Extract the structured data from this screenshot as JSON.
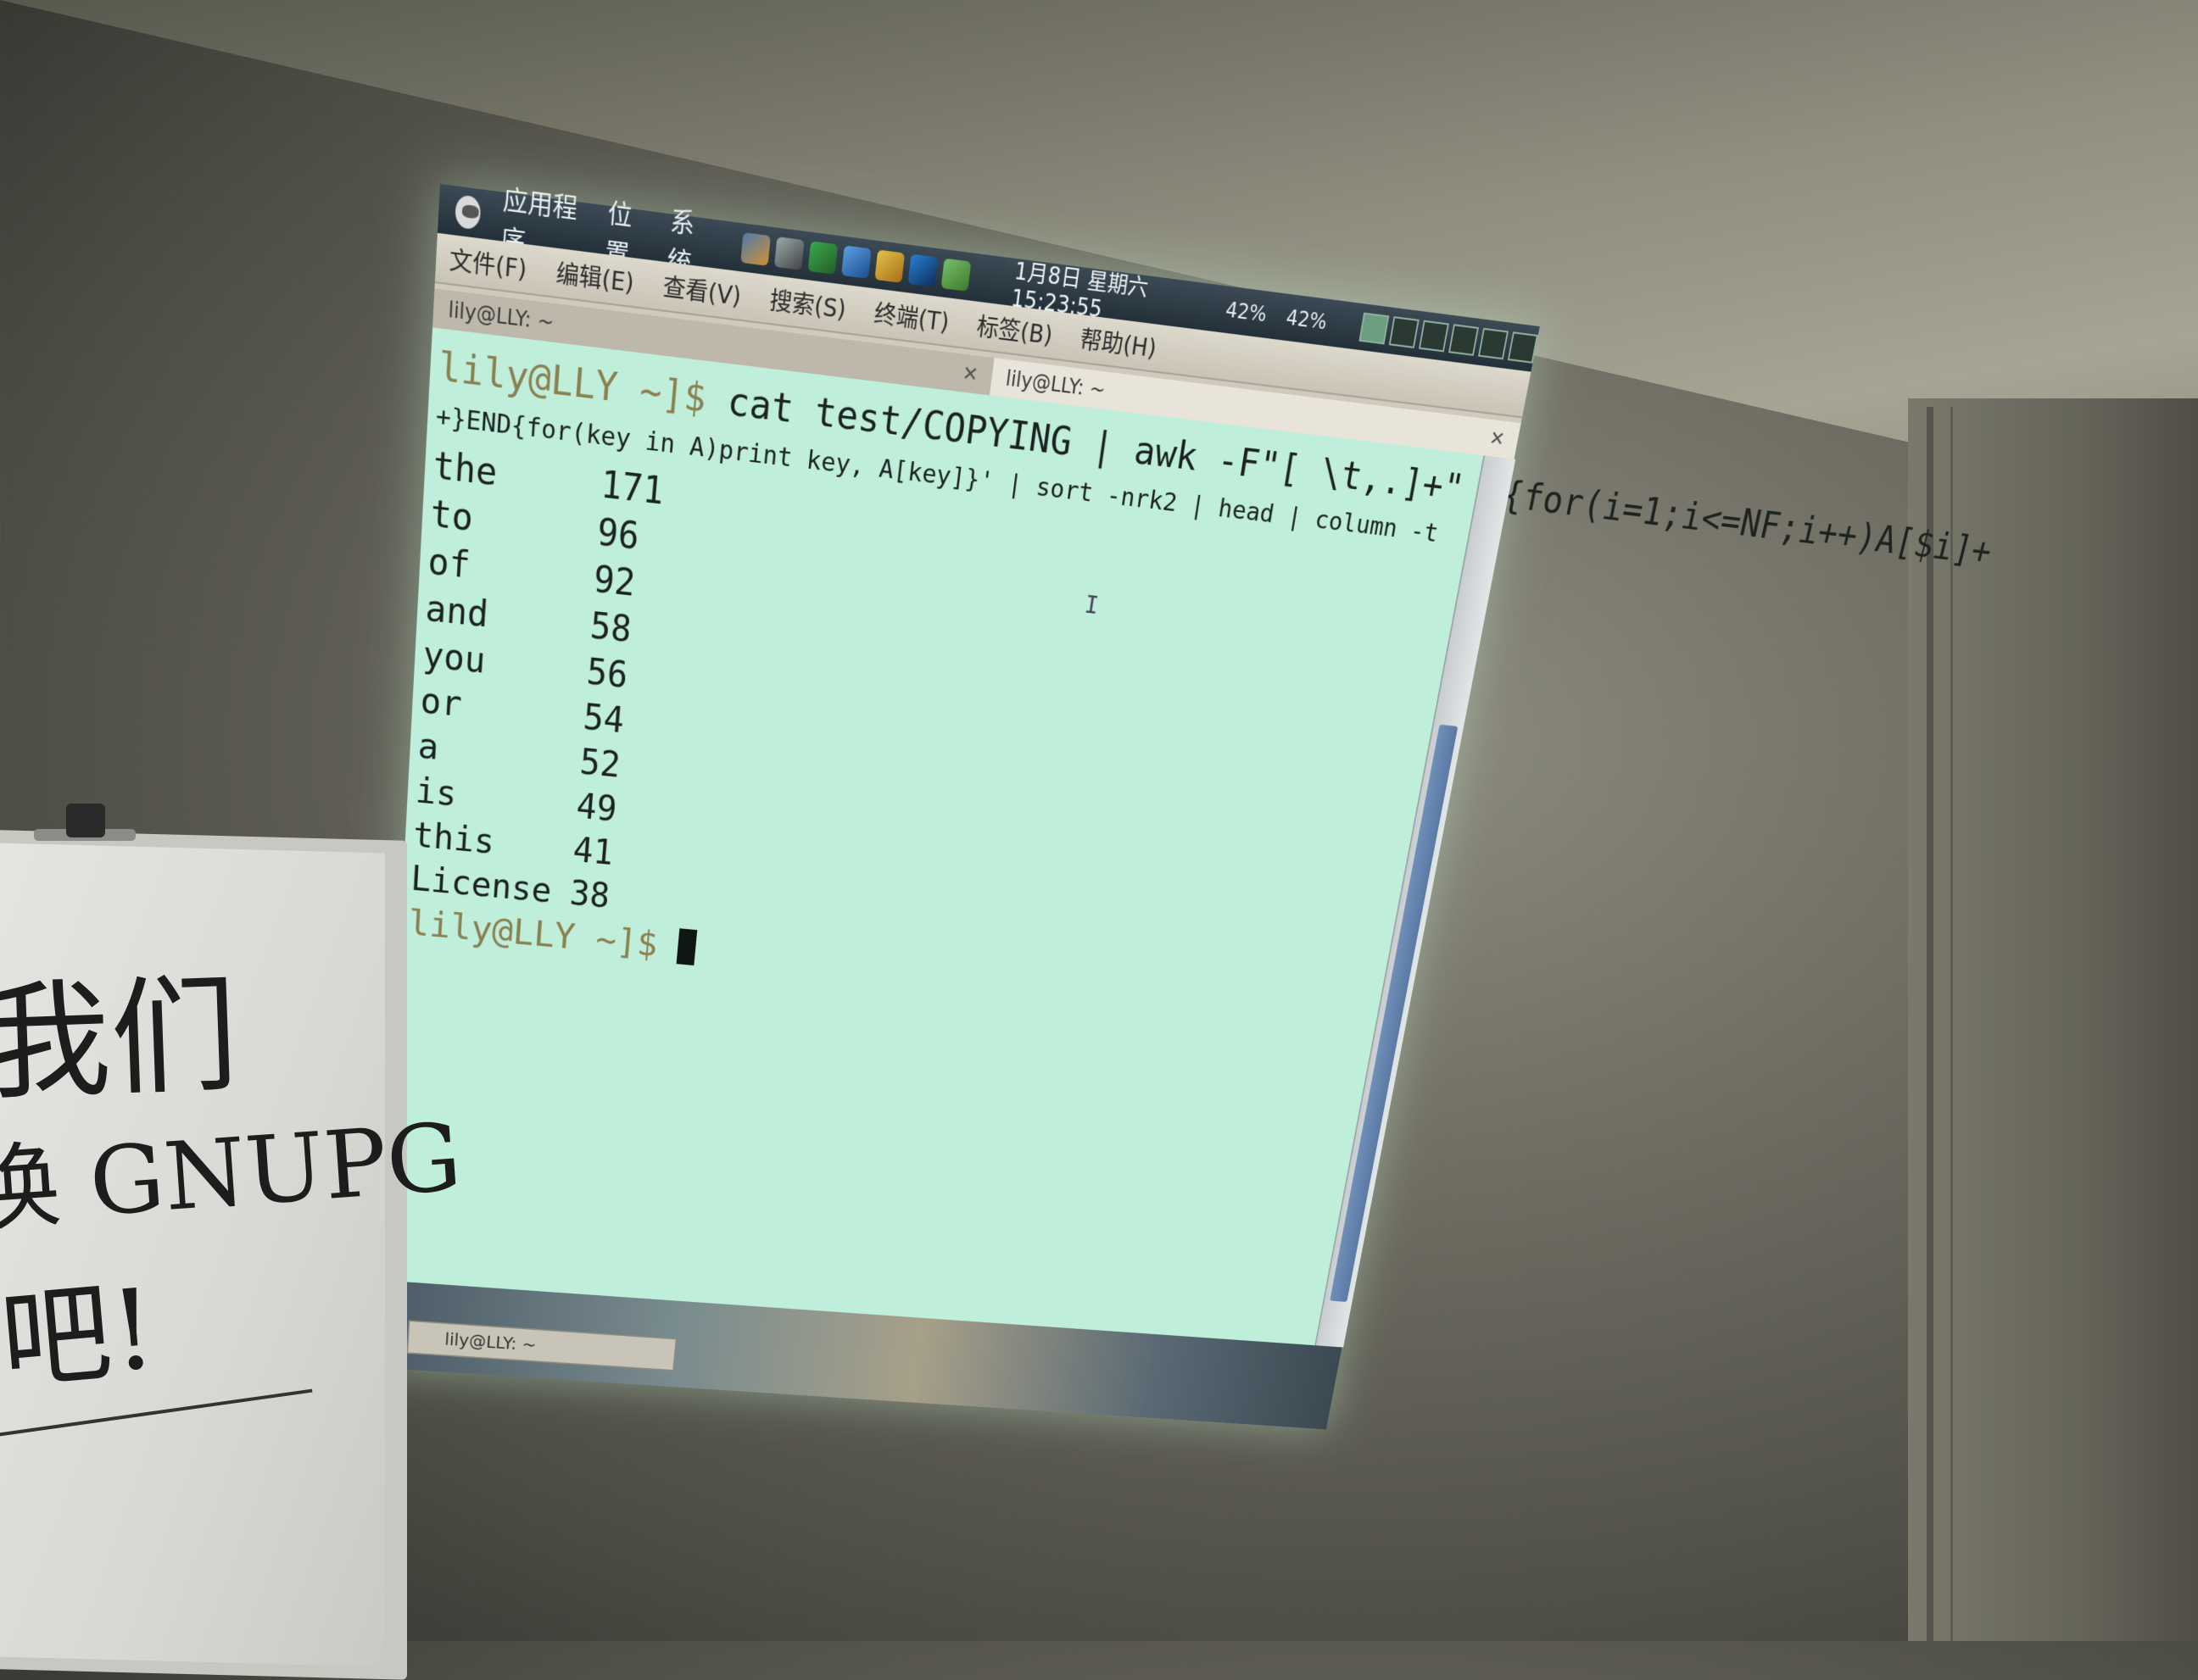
{
  "gnome_panel": {
    "menus": [
      "应用程序",
      "位置",
      "系统"
    ],
    "clock": "1月8日 星期六 15:23:55",
    "battery_1": "42%",
    "battery_2": "42%"
  },
  "terminal": {
    "menu": [
      "文件(F)",
      "编辑(E)",
      "查看(V)",
      "搜索(S)",
      "终端(T)",
      "标签(B)",
      "帮助(H)"
    ],
    "tabs": [
      {
        "label": "lily@LLY: ~"
      },
      {
        "label": "lily@LLY: ~"
      }
    ],
    "prompt": "lily@LLY ~]$",
    "command_line_1": " cat test/COPYING | awk -F\"[ \\t,.]+\" '{for(i=1;i<=NF;i++)A[$i]+",
    "command_line_2": "+}END{for(key in A)print key, A[key]}' | sort -nrk2 | head | column -t",
    "results": [
      {
        "word": "the",
        "count": "171"
      },
      {
        "word": "to",
        "count": "96"
      },
      {
        "word": "of",
        "count": "92"
      },
      {
        "word": "and",
        "count": "58"
      },
      {
        "word": "you",
        "count": "56"
      },
      {
        "word": "or",
        "count": "54"
      },
      {
        "word": "a",
        "count": "52"
      },
      {
        "word": "is",
        "count": "49"
      },
      {
        "word": "this",
        "count": "41"
      },
      {
        "word": "License",
        "count": "38"
      }
    ]
  },
  "taskbar": {
    "window_button": "lily@LLY: ~"
  },
  "whiteboard": {
    "line_1": "我们",
    "line_2": "换 GNUPG",
    "line_3": "吧!"
  }
}
